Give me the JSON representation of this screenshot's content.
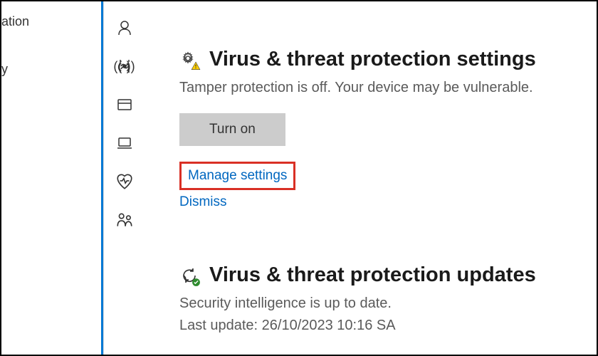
{
  "leftmost": {
    "item1": "ation",
    "item2": "y"
  },
  "settings_section": {
    "title": "Virus & threat protection settings",
    "description": "Tamper protection is off. Your device may be vulnerable.",
    "turn_on": "Turn on",
    "manage": "Manage settings",
    "dismiss": "Dismiss"
  },
  "updates_section": {
    "title": "Virus & threat protection updates",
    "description": "Security intelligence is up to date.",
    "last_update_label": "Last update:",
    "last_update_value": "26/10/2023 10:16 SA"
  }
}
